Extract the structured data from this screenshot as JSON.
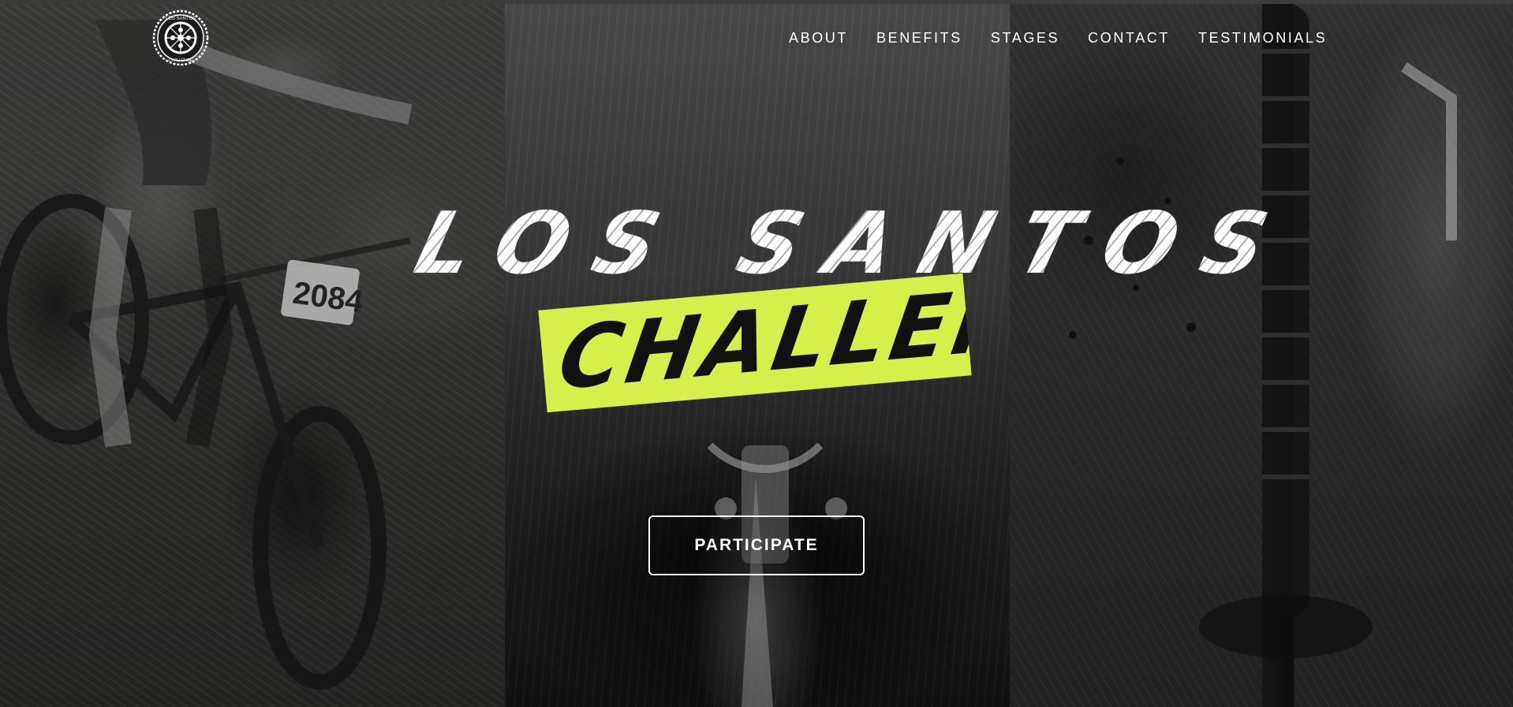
{
  "logo": {
    "top_text": "LOS SANTOS",
    "bottom_text": "CHALLENGE",
    "icon": "bike-wheel-logo"
  },
  "nav": {
    "items": [
      {
        "label": "ABOUT"
      },
      {
        "label": "BENEFITS"
      },
      {
        "label": "STAGES"
      },
      {
        "label": "CONTACT"
      },
      {
        "label": "TESTIMONIALS"
      }
    ]
  },
  "hero": {
    "title": "LOS SANTOS",
    "subtitle": "CHALLENGE",
    "race_number": "2084",
    "cta_label": "PARTICIPATE"
  },
  "colors": {
    "accent": "#d6ef4a",
    "text": "#ffffff"
  }
}
